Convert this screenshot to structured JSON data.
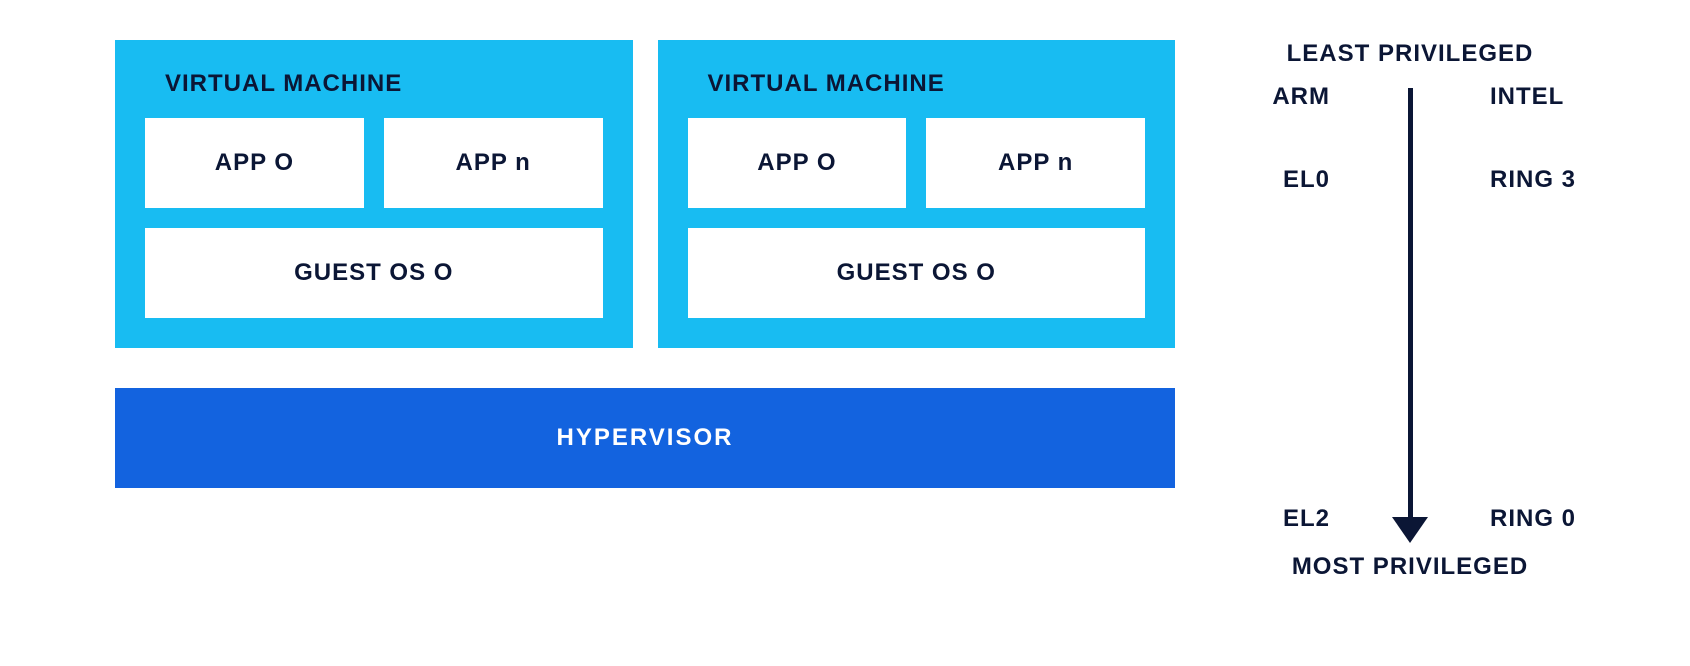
{
  "vms": [
    {
      "title": "VIRTUAL MACHINE",
      "apps": [
        "APP O",
        "APP n"
      ],
      "guest": "GUEST OS O"
    },
    {
      "title": "VIRTUAL MACHINE",
      "apps": [
        "APP O",
        "APP n"
      ],
      "guest": "GUEST OS O"
    }
  ],
  "hypervisor": "HYPERVISOR",
  "privilege": {
    "top_label": "LEAST PRIVILEGED",
    "bottom_label": "MOST PRIVILEGED",
    "arm": {
      "heading": "ARM",
      "top": "EL0",
      "bottom": "EL2"
    },
    "intel": {
      "heading": "INTEL",
      "top": "RING 3",
      "bottom": "RING 0"
    }
  },
  "colors": {
    "vm_background": "#18BCF2",
    "hypervisor_background": "#1363DF",
    "text_dark": "#0B1635",
    "box_white": "#ffffff"
  }
}
